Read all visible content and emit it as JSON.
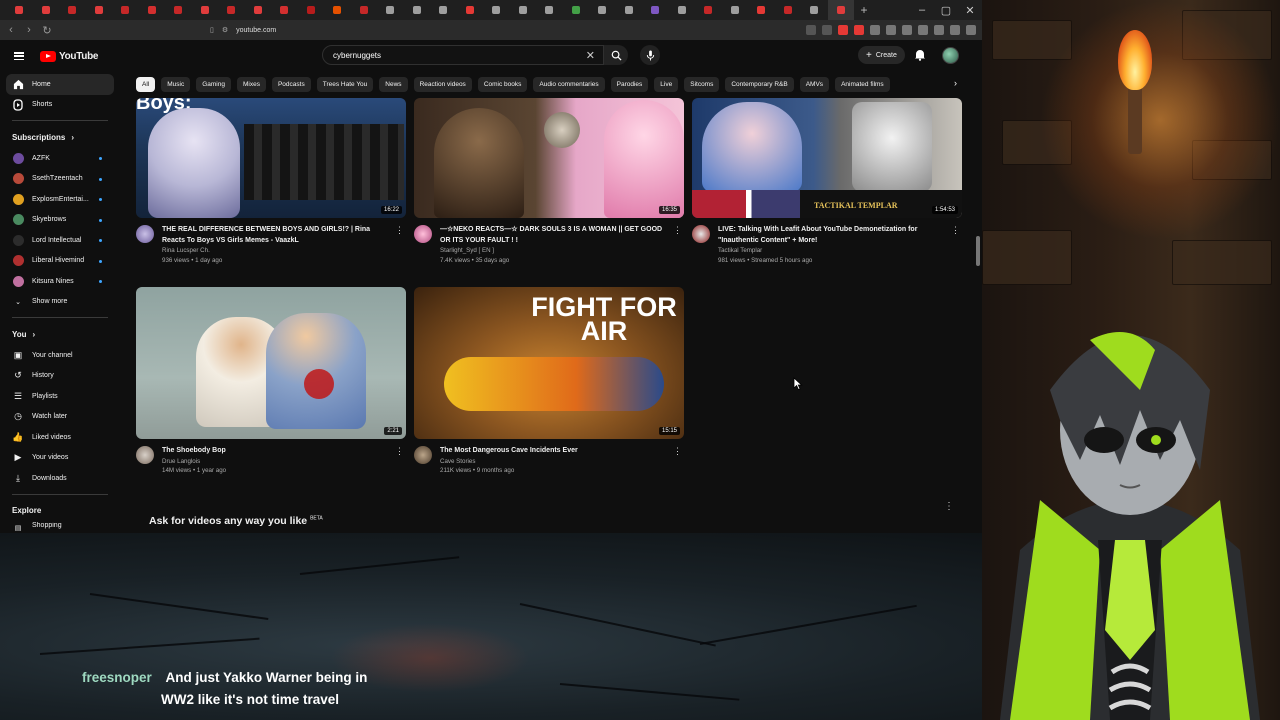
{
  "browser": {
    "url": "youtube.com",
    "tab_colors": [
      "#e03c3c",
      "#e03c3c",
      "#c62828",
      "#e03c3c",
      "#c62828",
      "#d32f2f",
      "#c62828",
      "#e03c3c",
      "#c62828",
      "#e03c3c",
      "#d32f2f",
      "#b71c1c",
      "#e65100",
      "#c62828",
      "#9e9e9e",
      "#9e9e9e",
      "#9e9e9e",
      "#e53935",
      "#9e9e9e",
      "#9e9e9e",
      "#9e9e9e",
      "#43a047",
      "#9e9e9e",
      "#9e9e9e",
      "#7e57c2",
      "#9e9e9e",
      "#c62828",
      "#9e9e9e",
      "#e53935",
      "#c62828",
      "#9e9e9e",
      "#e03c3c"
    ]
  },
  "header": {
    "logo_text": "YouTube",
    "search_value": "cybernuggets",
    "create_label": "Create"
  },
  "sidebar": {
    "main": [
      {
        "label": "Home",
        "icon": "home-icon"
      },
      {
        "label": "Shorts",
        "icon": "shorts-icon"
      }
    ],
    "subscriptions_title": "Subscriptions",
    "subscriptions": [
      {
        "label": "AZFK",
        "color": "#6d4c9e"
      },
      {
        "label": "SsethTzeentach",
        "color": "#b84a3a"
      },
      {
        "label": "ExplosmEntertai...",
        "color": "#e0a020"
      },
      {
        "label": "Skyebrows",
        "color": "#4a8a60"
      },
      {
        "label": "Lord Intellectual",
        "color": "#2c2c2c"
      },
      {
        "label": "Liberal Hivemind",
        "color": "#b03030"
      },
      {
        "label": "Kitsura Nines",
        "color": "#c070a0"
      }
    ],
    "show_more": "Show more",
    "you_title": "You",
    "you_items": [
      {
        "label": "Your channel",
        "icon": "channel-icon"
      },
      {
        "label": "History",
        "icon": "history-icon"
      },
      {
        "label": "Playlists",
        "icon": "playlists-icon"
      },
      {
        "label": "Watch later",
        "icon": "watch-later-icon"
      },
      {
        "label": "Liked videos",
        "icon": "like-icon"
      },
      {
        "label": "Your videos",
        "icon": "your-videos-icon"
      },
      {
        "label": "Downloads",
        "icon": "download-icon"
      }
    ],
    "explore_title": "Explore",
    "explore_partial": "Shopping"
  },
  "chips": [
    "All",
    "Music",
    "Gaming",
    "Mixes",
    "Podcasts",
    "Trees Hate You",
    "News",
    "Reaction videos",
    "Comic books",
    "Audio commentaries",
    "Parodies",
    "Live",
    "Sitcoms",
    "Contemporary R&B",
    "AMVs",
    "Animated films"
  ],
  "videos": [
    {
      "title": "THE REAL DIFFERENCE BETWEEN BOYS AND GIRLS!? | Rina Reacts To Boys VS Girls Memes - VaazkL",
      "channel": "Rina Lucsper Ch.",
      "stats": "936 views • 1 day ago",
      "duration": "16:22",
      "thumb_partial_text": "Boys:"
    },
    {
      "title": "—☆NEKO REACTS—☆ DARK SOULS 3 IS A WOMAN || GET GOOD OR ITS YOUR FAULT ! !",
      "channel": "Starlight_Syd [ EN ]",
      "stats": "7.4K views • 35 days ago",
      "duration": "16:35"
    },
    {
      "title": "LIVE: Talking With Leafit About YouTube Demonetization for \"Inauthentic Content\" + More!",
      "channel": "Tactikal Templar",
      "stats": "981 views • Streamed 5 hours ago",
      "duration": "1:54:53",
      "thumb_banner": "TACTIKAL TEMPLAR"
    },
    {
      "title": "The Shoebody Bop",
      "channel": "Drue Langlois",
      "stats": "14M views • 1 year ago",
      "duration": "2:21"
    },
    {
      "title": "The Most Dangerous Cave Incidents Ever",
      "channel": "Cave Stories",
      "stats": "211K views • 9 months ago",
      "duration": "15:15",
      "thumb_text": "FIGHT FOR AIR"
    }
  ],
  "ask": {
    "text": "Ask for videos any way you like",
    "beta": "BETA"
  },
  "chat": {
    "user": "freesnoper",
    "line1": "And just Yakko Warner being in",
    "line2": "WW2 like it's not time travel"
  }
}
